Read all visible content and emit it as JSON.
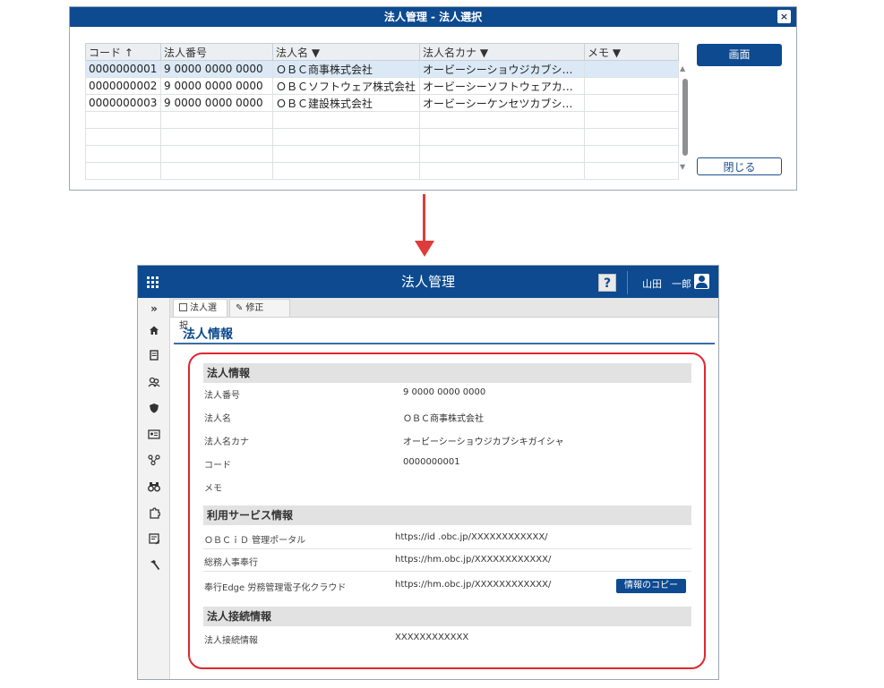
{
  "dialog": {
    "title": "法人管理 - 法人選択",
    "close_glyph": "×",
    "columns": [
      "コード ↑",
      "法人番号",
      "法人名 ▼",
      "法人名カナ ▼",
      "メモ ▼"
    ],
    "rows": [
      [
        "0000000001",
        "9 0000 0000 0000",
        "ＯＢＣ商事株式会社",
        "オービーシーショウジカブシキ…",
        ""
      ],
      [
        "0000000002",
        "9 0000 0000 0000",
        "ＯＢＣソフトウェア株式会社",
        "オービーシーソフトウェアカブ…",
        ""
      ],
      [
        "0000000003",
        "9 0000 0000 0000",
        "ＯＢＣ建設株式会社",
        "オービーシーケンセツカブシキ…",
        ""
      ]
    ],
    "screen_button": "画面",
    "close_button": "閉じる"
  },
  "app": {
    "title": "法人管理",
    "help": "?",
    "user_name": "山田　一郎",
    "tabs": [
      {
        "label": "法人選択",
        "icon": "building-icon"
      },
      {
        "label": "修正",
        "icon": "pencil-icon"
      }
    ],
    "sidebar_icons": [
      "expand-icon",
      "home-icon",
      "document-icon",
      "people-icon",
      "shield-icon",
      "id-card-icon",
      "network-icon",
      "binoculars-icon",
      "puzzle-icon",
      "form-icon",
      "hammer-icon"
    ],
    "page_title": "法人情報",
    "section_corp": {
      "title": "法人情報",
      "fields": [
        {
          "label": "法人番号",
          "value": "9 0000 0000 0000"
        },
        {
          "label": "法人名",
          "value": "ＯＢＣ商事株式会社"
        },
        {
          "label": "法人名カナ",
          "value": "オービーシーショウジカブシキガイシャ"
        },
        {
          "label": "コード",
          "value": "0000000001"
        },
        {
          "label": "メモ",
          "value": ""
        }
      ]
    },
    "section_services": {
      "title": "利用サービス情報",
      "rows": [
        {
          "label": "ＯＢＣｉＤ 管理ポータル",
          "url": "https://id .obc.jp/XXXXXXXXXXXX/"
        },
        {
          "label": "総務人事奉行",
          "url": "https://hm.obc.jp/XXXXXXXXXXXX/"
        },
        {
          "label": "奉行Edge 労務管理電子化クラウド",
          "url": "https://hm.obc.jp/XXXXXXXXXXXX/"
        }
      ],
      "copy_button": "情報のコピー"
    },
    "section_connection": {
      "title": "法人接続情報",
      "label": "法人接続情報",
      "value": "XXXXXXXXXXXX"
    }
  },
  "colors": {
    "header_blue": "#0d4a8f",
    "arrow_red": "#e03b3b",
    "highlight_red": "#e0262f",
    "selected_row": "#dbe9f6"
  }
}
